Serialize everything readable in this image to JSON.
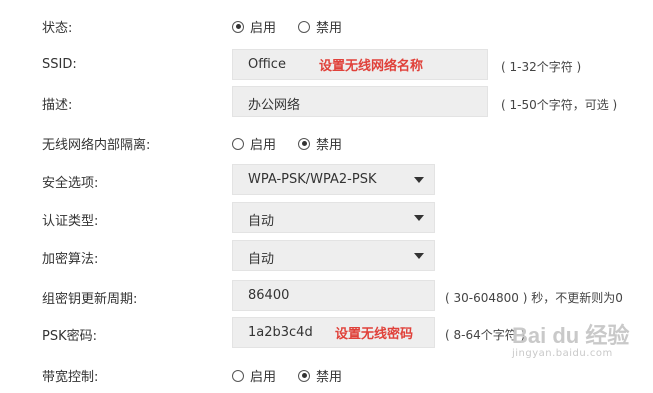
{
  "rows": {
    "status": {
      "label": "状态:",
      "options": [
        "启用",
        "禁用"
      ],
      "selected": 0
    },
    "ssid": {
      "label": "SSID:",
      "value": "Office",
      "annotation": "设置无线网络名称",
      "hint": "( 1-32个字符 )"
    },
    "description": {
      "label": "描述:",
      "value": "办公网络",
      "hint": "( 1-50个字符，可选 )"
    },
    "isolation": {
      "label": "无线网络内部隔离:",
      "options": [
        "启用",
        "禁用"
      ],
      "selected": 1
    },
    "security": {
      "label": "安全选项:",
      "value": "WPA-PSK/WPA2-PSK"
    },
    "auth_type": {
      "label": "认证类型:",
      "value": "自动"
    },
    "encryption": {
      "label": "加密算法:",
      "value": "自动"
    },
    "group_key": {
      "label": "组密钥更新周期:",
      "value": "86400",
      "hint": "( 30-604800 ) 秒，不更新则为0"
    },
    "psk": {
      "label": "PSK密码:",
      "value": "1a2b3c4d",
      "annotation": "设置无线密码",
      "hint": "( 8-64个字符 )"
    },
    "bandwidth": {
      "label": "带宽控制:",
      "options": [
        "启用",
        "禁用"
      ],
      "selected": 1
    }
  },
  "watermark": {
    "logo": "Bai du 经验",
    "sub": "jingyan.baidu.com"
  },
  "colors": {
    "annotation": "#e0413a",
    "field_bg": "#eeeeee"
  }
}
